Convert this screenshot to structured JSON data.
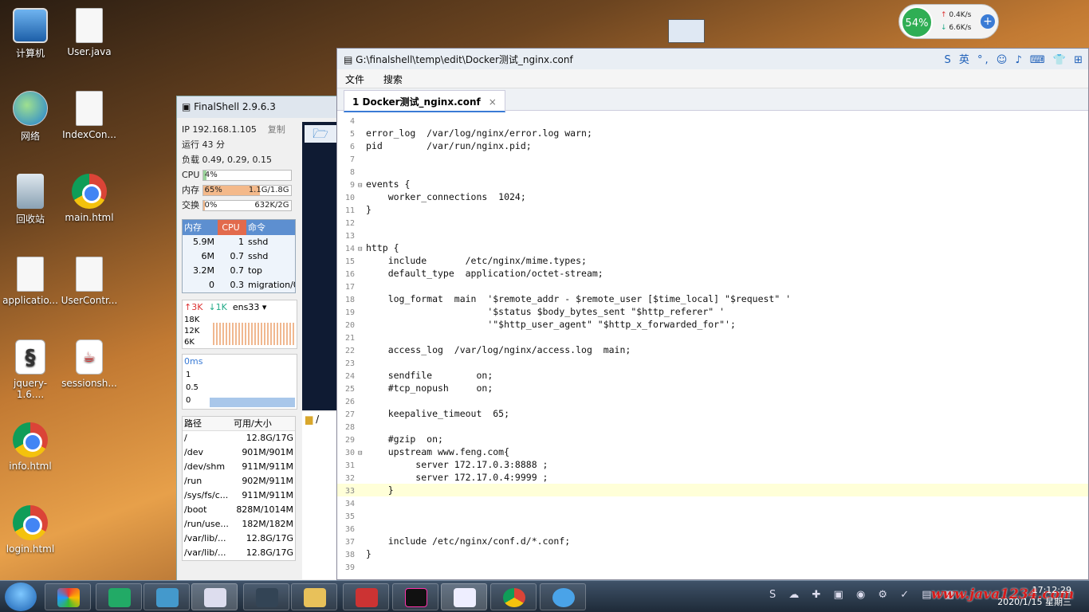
{
  "desktop": {
    "icons": [
      {
        "label": "计算机",
        "kind": "pc"
      },
      {
        "label": "User.java",
        "kind": "file"
      },
      {
        "label": "网络",
        "kind": "net"
      },
      {
        "label": "IndexCon...",
        "kind": "file"
      },
      {
        "label": "回收站",
        "kind": "bin"
      },
      {
        "label": "main.html",
        "kind": "chrome"
      },
      {
        "label": "applicatio...",
        "kind": "file"
      },
      {
        "label": "UserContr...",
        "kind": "file"
      },
      {
        "label": "jquery-1.6....",
        "kind": "jq"
      },
      {
        "label": "sessionsh...",
        "kind": "java"
      },
      {
        "label": "info.html",
        "kind": "chrome"
      },
      {
        "label": "login.html",
        "kind": "chrome"
      }
    ]
  },
  "widget": {
    "percent": "54%",
    "up": "0.4K/s",
    "down": "6.6K/s",
    "up_arrow": "↑",
    "down_arrow": "↓",
    "plus": "+"
  },
  "finalshell": {
    "title": "FinalShell 2.9.6.3",
    "ip": "IP 192.168.1.105",
    "copy": "复制",
    "uptime": "运行 43 分",
    "load": "负载 0.49, 0.29, 0.15",
    "cpu": {
      "label": "CPU",
      "value": "4%",
      "fraction": 0.04
    },
    "mem": {
      "label": "内存",
      "value": "65%",
      "detail": "1.1G/1.8G",
      "fraction": 0.65
    },
    "swap": {
      "label": "交换",
      "value": "0%",
      "detail": "632K/2G",
      "fraction": 0.0
    },
    "proc_headers": [
      "内存",
      "CPU",
      "命令"
    ],
    "procs": [
      {
        "mem": "5.9M",
        "cpu": "1",
        "cmd": "sshd"
      },
      {
        "mem": "6M",
        "cpu": "0.7",
        "cmd": "sshd"
      },
      {
        "mem": "3.2M",
        "cpu": "0.7",
        "cmd": "top"
      },
      {
        "mem": "0",
        "cpu": "0.3",
        "cmd": "migration/0"
      }
    ],
    "net": {
      "up": "↑3K",
      "down": "↓1K",
      "iface": "ens33",
      "ticks": [
        "18K",
        "12K",
        "6K"
      ]
    },
    "latency": {
      "label": "0ms",
      "ticks": [
        "1",
        "0.5",
        "0"
      ]
    },
    "disk_headers": [
      "路径",
      "可用/大小"
    ],
    "disks": [
      {
        "path": "/",
        "size": "12.8G/17G"
      },
      {
        "path": "/dev",
        "size": "901M/901M"
      },
      {
        "path": "/dev/shm",
        "size": "911M/911M"
      },
      {
        "path": "/run",
        "size": "902M/911M"
      },
      {
        "path": "/sys/fs/c...",
        "size": "911M/911M"
      },
      {
        "path": "/boot",
        "size": "828M/1014M"
      },
      {
        "path": "/run/use...",
        "size": "182M/182M"
      },
      {
        "path": "/var/lib/...",
        "size": "12.8G/17G"
      },
      {
        "path": "/var/lib/...",
        "size": "12.8G/17G"
      }
    ],
    "tree_root": "/"
  },
  "editor": {
    "title": "G:\\finalshell\\temp\\edit\\Docker测试_nginx.conf",
    "tray": "S 英 °, ☺ ♪ ⌨ 👕 ⊞",
    "menu": [
      "文件",
      "搜索"
    ],
    "tab": "1 Docker测试_nginx.conf",
    "tab_close": "×",
    "lines": [
      {
        "n": "4",
        "t": "",
        "fold": ""
      },
      {
        "n": "5",
        "t": "error_log  /var/log/nginx/error.log warn;",
        "fold": ""
      },
      {
        "n": "6",
        "t": "pid        /var/run/nginx.pid;",
        "fold": ""
      },
      {
        "n": "7",
        "t": "",
        "fold": ""
      },
      {
        "n": "8",
        "t": "",
        "fold": ""
      },
      {
        "n": "9",
        "t": "events {",
        "fold": "⊟"
      },
      {
        "n": "10",
        "t": "    worker_connections  1024;",
        "fold": ""
      },
      {
        "n": "11",
        "t": "}",
        "fold": ""
      },
      {
        "n": "12",
        "t": "",
        "fold": ""
      },
      {
        "n": "13",
        "t": "",
        "fold": ""
      },
      {
        "n": "14",
        "t": "http {",
        "fold": "⊟"
      },
      {
        "n": "15",
        "t": "    include       /etc/nginx/mime.types;",
        "fold": ""
      },
      {
        "n": "16",
        "t": "    default_type  application/octet-stream;",
        "fold": ""
      },
      {
        "n": "17",
        "t": "",
        "fold": ""
      },
      {
        "n": "18",
        "t": "    log_format  main  '$remote_addr - $remote_user [$time_local] \"$request\" '",
        "fold": ""
      },
      {
        "n": "19",
        "t": "                      '$status $body_bytes_sent \"$http_referer\" '",
        "fold": ""
      },
      {
        "n": "20",
        "t": "                      '\"$http_user_agent\" \"$http_x_forwarded_for\"';",
        "fold": ""
      },
      {
        "n": "21",
        "t": "",
        "fold": ""
      },
      {
        "n": "22",
        "t": "    access_log  /var/log/nginx/access.log  main;",
        "fold": ""
      },
      {
        "n": "23",
        "t": "",
        "fold": ""
      },
      {
        "n": "24",
        "t": "    sendfile        on;",
        "fold": ""
      },
      {
        "n": "25",
        "t": "    #tcp_nopush     on;",
        "fold": ""
      },
      {
        "n": "26",
        "t": "",
        "fold": ""
      },
      {
        "n": "27",
        "t": "    keepalive_timeout  65;",
        "fold": ""
      },
      {
        "n": "28",
        "t": "",
        "fold": ""
      },
      {
        "n": "29",
        "t": "    #gzip  on;",
        "fold": ""
      },
      {
        "n": "30",
        "t": "    upstream www.feng.com{",
        "fold": "⊟"
      },
      {
        "n": "31",
        "t": "         server 172.17.0.3:8888 ;",
        "fold": ""
      },
      {
        "n": "32",
        "t": "         server 172.17.0.4:9999 ;",
        "fold": ""
      },
      {
        "n": "33",
        "t": "    }",
        "fold": "",
        "hl": true
      },
      {
        "n": "34",
        "t": "",
        "fold": ""
      },
      {
        "n": "35",
        "t": "",
        "fold": ""
      },
      {
        "n": "36",
        "t": "",
        "fold": ""
      },
      {
        "n": "37",
        "t": "    include /etc/nginx/conf.d/*.conf;",
        "fold": ""
      },
      {
        "n": "38",
        "t": "}",
        "fold": ""
      },
      {
        "n": "39",
        "t": "",
        "fold": ""
      }
    ]
  },
  "taskbar": {
    "tray": "S ☁ ✚ ▣ ◉ ⚙ ✓ ▤ ▦",
    "watermark": "www.java1234.com",
    "time": "17:12:29",
    "date": "2020/1/15 星期三"
  },
  "colors": {
    "accent": "#3a7bd5",
    "highlight_line": "#ffffd8",
    "mem_bar": "#f4b98a"
  }
}
